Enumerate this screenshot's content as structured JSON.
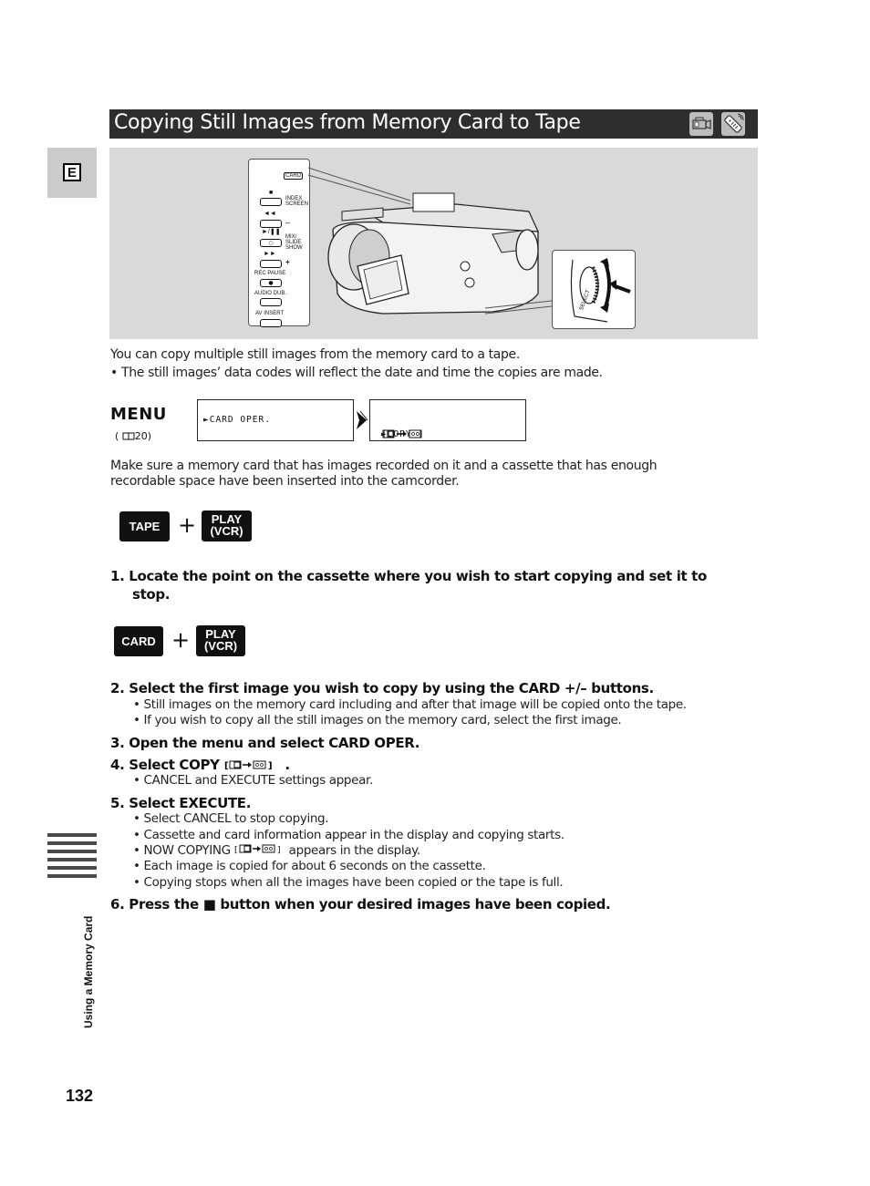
{
  "language_tab": "E",
  "header": {
    "title": "Copying Still Images from Memory Card to Tape",
    "mode_icons": [
      "camcorder-icon",
      "remote-control-icon"
    ]
  },
  "illustration": {
    "panel_labels": {
      "card": "CARD",
      "stop_symbol": "■",
      "index_screen": "INDEX SCREEN",
      "rewind_symbol": "◄◄",
      "minus": "–",
      "play_pause_symbol": "►/❚❚",
      "mix_slide_show": "MIX/ SLIDE SHOW",
      "play_btn_symbol": "○",
      "ff_symbol": "►►",
      "plus": "+",
      "rec_pause": "REC PAUSE",
      "rec_btn_symbol": "●",
      "audio_dub": "AUDIO DUB.",
      "av_insert": "AV INSERT"
    },
    "dial_label": "SELECT"
  },
  "intro": {
    "line1": "You can copy multiple still images from the memory card to a tape.",
    "bullet1": "• The still images’ data codes will reflect the date and time the copies are made."
  },
  "menu": {
    "word": "MENU",
    "ref": "(  20)",
    "ref_page": "20",
    "step1": "►CARD OPER.",
    "step2": "►COPY [",
    "step2_end": "]"
  },
  "prereq": {
    "line1": "Make sure a memory card that has images recorded on it and a cassette that has enough",
    "line2": "recordable space have been inserted into the camcorder."
  },
  "mode1": {
    "left": "TAPE",
    "plus": "+",
    "right_line1": "PLAY",
    "right_line2": "(VCR)"
  },
  "mode2": {
    "left": "CARD",
    "plus": "+",
    "right_line1": "PLAY",
    "right_line2": "(VCR)"
  },
  "steps": {
    "s1_line1": "1.  Locate the point on the cassette where you wish to start copying and set it to",
    "s1_line2": "stop.",
    "s2": "2.  Select the first image you wish to copy by using the CARD +/– buttons.",
    "s2_b1": "• Still images on the memory card including and after that image will be copied onto the tape.",
    "s2_b2": "• If you wish to copy all the still images on the memory card, select the first image.",
    "s3": "3.  Open the menu and select CARD OPER.",
    "s4": "4.  Select COPY",
    "s4_end": ".",
    "s4_b1": "• CANCEL and EXECUTE settings appear.",
    "s5": "5.  Select EXECUTE.",
    "s5_b1": "• Select CANCEL to stop copying.",
    "s5_b2": "• Cassette and card information appear in the display and copying starts.",
    "s5_b3_pre": "• NOW COPYING",
    "s5_b3_post": "appears in the display.",
    "s5_b4": "• Each image is copied for about 6 seconds on the cassette.",
    "s5_b5": "• Copying stops when all the images have been copied or the tape is full.",
    "s6_pre": "6.  Press the",
    "s6_symbol": "■",
    "s6_post": "button when your desired images have been copied."
  },
  "sidebar": {
    "section_label": "Using a Memory Card"
  },
  "page_number": "132"
}
